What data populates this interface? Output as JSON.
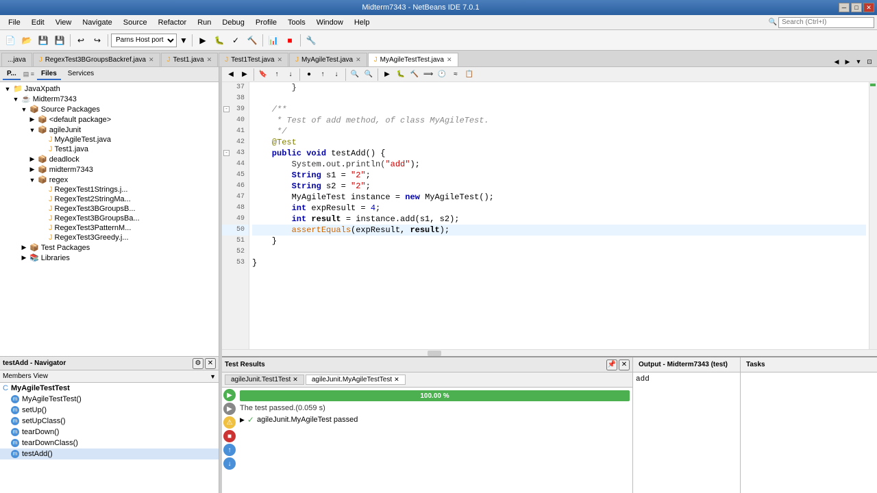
{
  "titleBar": {
    "title": "Midterm7343 - NetBeans IDE 7.0.1",
    "minimizeBtn": "─",
    "maximizeBtn": "□",
    "closeBtn": "✕"
  },
  "menu": {
    "items": [
      "File",
      "Edit",
      "View",
      "Navigate",
      "Source",
      "Refactor",
      "Run",
      "Debug",
      "Profile",
      "Tools",
      "Window",
      "Help"
    ]
  },
  "toolbar": {
    "hostPort": "Parns Host port"
  },
  "projectTabs": {
    "pLabel": "P...",
    "filesLabel": "Files",
    "servicesLabel": "Services"
  },
  "fileTree": {
    "items": [
      {
        "label": "JavaXpath",
        "level": 0,
        "expanded": true,
        "type": "folder"
      },
      {
        "label": "Midterm7343",
        "level": 1,
        "expanded": true,
        "type": "project"
      },
      {
        "label": "Source Packages",
        "level": 2,
        "expanded": true,
        "type": "folder"
      },
      {
        "label": "<default package>",
        "level": 3,
        "expanded": false,
        "type": "package"
      },
      {
        "label": "agileJunit",
        "level": 3,
        "expanded": true,
        "type": "package"
      },
      {
        "label": "MyAgileTest.java",
        "level": 4,
        "expanded": false,
        "type": "java"
      },
      {
        "label": "Test1.java",
        "level": 4,
        "expanded": false,
        "type": "java"
      },
      {
        "label": "deadlock",
        "level": 3,
        "expanded": false,
        "type": "package"
      },
      {
        "label": "midterm7343",
        "level": 3,
        "expanded": false,
        "type": "package"
      },
      {
        "label": "regex",
        "level": 3,
        "expanded": true,
        "type": "package"
      },
      {
        "label": "RegexTest1Strings.j...",
        "level": 4,
        "expanded": false,
        "type": "java"
      },
      {
        "label": "RegexTest2StringMa...",
        "level": 4,
        "expanded": false,
        "type": "java"
      },
      {
        "label": "RegexTest3BGroupsB...",
        "level": 4,
        "expanded": false,
        "type": "java"
      },
      {
        "label": "RegexTest3BGroupsBa...",
        "level": 4,
        "expanded": false,
        "type": "java"
      },
      {
        "label": "RegexTest3PatternM...",
        "level": 4,
        "expanded": false,
        "type": "java"
      },
      {
        "label": "RegexTest3Greedy.j...",
        "level": 4,
        "expanded": false,
        "type": "java"
      },
      {
        "label": "Test Packages",
        "level": 2,
        "expanded": false,
        "type": "folder"
      },
      {
        "label": "Libraries",
        "level": 2,
        "expanded": false,
        "type": "folder"
      }
    ]
  },
  "editorTabs": [
    {
      "label": "...java",
      "active": false,
      "closeable": false
    },
    {
      "label": "RegexTest3BGroupsBackref.java",
      "active": false,
      "closeable": true
    },
    {
      "label": "Test1.java",
      "active": false,
      "closeable": true
    },
    {
      "label": "Test1Test.java",
      "active": false,
      "closeable": true
    },
    {
      "label": "MyAgileTest.java",
      "active": false,
      "closeable": true
    },
    {
      "label": "MyAgileTestTest.java",
      "active": true,
      "closeable": true
    }
  ],
  "codeLines": [
    {
      "num": 37,
      "content": "        }"
    },
    {
      "num": 38,
      "content": ""
    },
    {
      "num": 39,
      "content": "    /**",
      "type": "comment",
      "fold": true
    },
    {
      "num": 40,
      "content": "     * Test of add method, of class MyAgileTest.",
      "type": "comment"
    },
    {
      "num": 41,
      "content": "     */",
      "type": "comment"
    },
    {
      "num": 42,
      "content": "    @Test",
      "type": "annotation"
    },
    {
      "num": 43,
      "content": "    public void testAdd() {",
      "type": "code",
      "fold": true
    },
    {
      "num": 44,
      "content": "        System.out.println(\"add\");",
      "type": "code"
    },
    {
      "num": 45,
      "content": "        String s1 = \"2\";",
      "type": "code"
    },
    {
      "num": 46,
      "content": "        String s2 = \"2\";",
      "type": "code"
    },
    {
      "num": 47,
      "content": "        MyAgileTest instance = new MyAgileTest();",
      "type": "code"
    },
    {
      "num": 48,
      "content": "        int expResult = 4;",
      "type": "code"
    },
    {
      "num": 49,
      "content": "        int result = instance.add(s1, s2);",
      "type": "code"
    },
    {
      "num": 50,
      "content": "        assertEquals(expResult, result);|",
      "type": "code",
      "highlighted": true
    },
    {
      "num": 51,
      "content": "    }"
    },
    {
      "num": 52,
      "content": ""
    },
    {
      "num": 53,
      "content": "}"
    }
  ],
  "navigator": {
    "title": "testAdd - Navigator",
    "subheader": "Members View",
    "className": "MyAgileTestTest",
    "methods": [
      {
        "name": "MyAgileTestTest()",
        "type": "public"
      },
      {
        "name": "setUp()",
        "type": "public"
      },
      {
        "name": "setUpClass()",
        "type": "public"
      },
      {
        "name": "tearDown()",
        "type": "public"
      },
      {
        "name": "tearDownClass()",
        "type": "public"
      },
      {
        "name": "testAdd()",
        "type": "public",
        "selected": true
      }
    ]
  },
  "testResults": {
    "panelTitle": "Test Results",
    "tabs": [
      {
        "label": "agileJunit.Test1Test",
        "active": false,
        "closeable": true
      },
      {
        "label": "agileJunit.MyAgileTestTest",
        "active": true,
        "closeable": true
      }
    ],
    "progressPercent": "100.00 %",
    "passText": "The test passed.(0.059 s)",
    "resultItem": "agileJunit.MyAgileTest passed"
  },
  "output": {
    "title": "Output - Midterm7343 (test)",
    "content": "add"
  },
  "tasks": {
    "title": "Tasks"
  }
}
